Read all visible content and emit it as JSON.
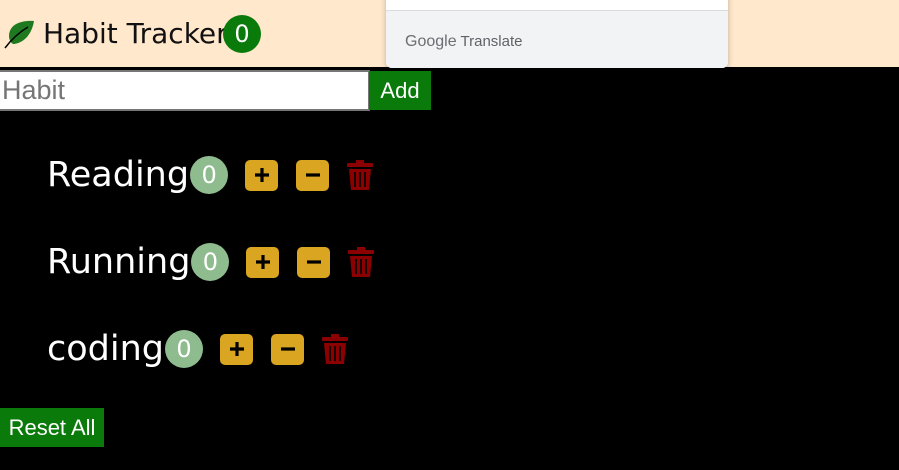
{
  "header": {
    "title": "Habit Tracker",
    "total_count": "0",
    "accent_color": "#0a7a0a",
    "background_color": "#ffe8cc",
    "logo_icon": "leaf-icon"
  },
  "translate_popup": {
    "brand": "Google",
    "product": "Translate"
  },
  "form": {
    "input_placeholder": "Habit",
    "input_value": "",
    "add_label": "Add"
  },
  "habits": [
    {
      "name": "Reading",
      "count": "0"
    },
    {
      "name": "Running",
      "count": "0"
    },
    {
      "name": "coding",
      "count": "0"
    }
  ],
  "controls": {
    "increment_icon": "plus-icon",
    "decrement_icon": "minus-icon",
    "delete_icon": "trash-icon",
    "control_color": "#daa520",
    "delete_color": "#8b0000",
    "badge_color": "#8fbc8f"
  },
  "footer": {
    "reset_label": "Reset All"
  }
}
